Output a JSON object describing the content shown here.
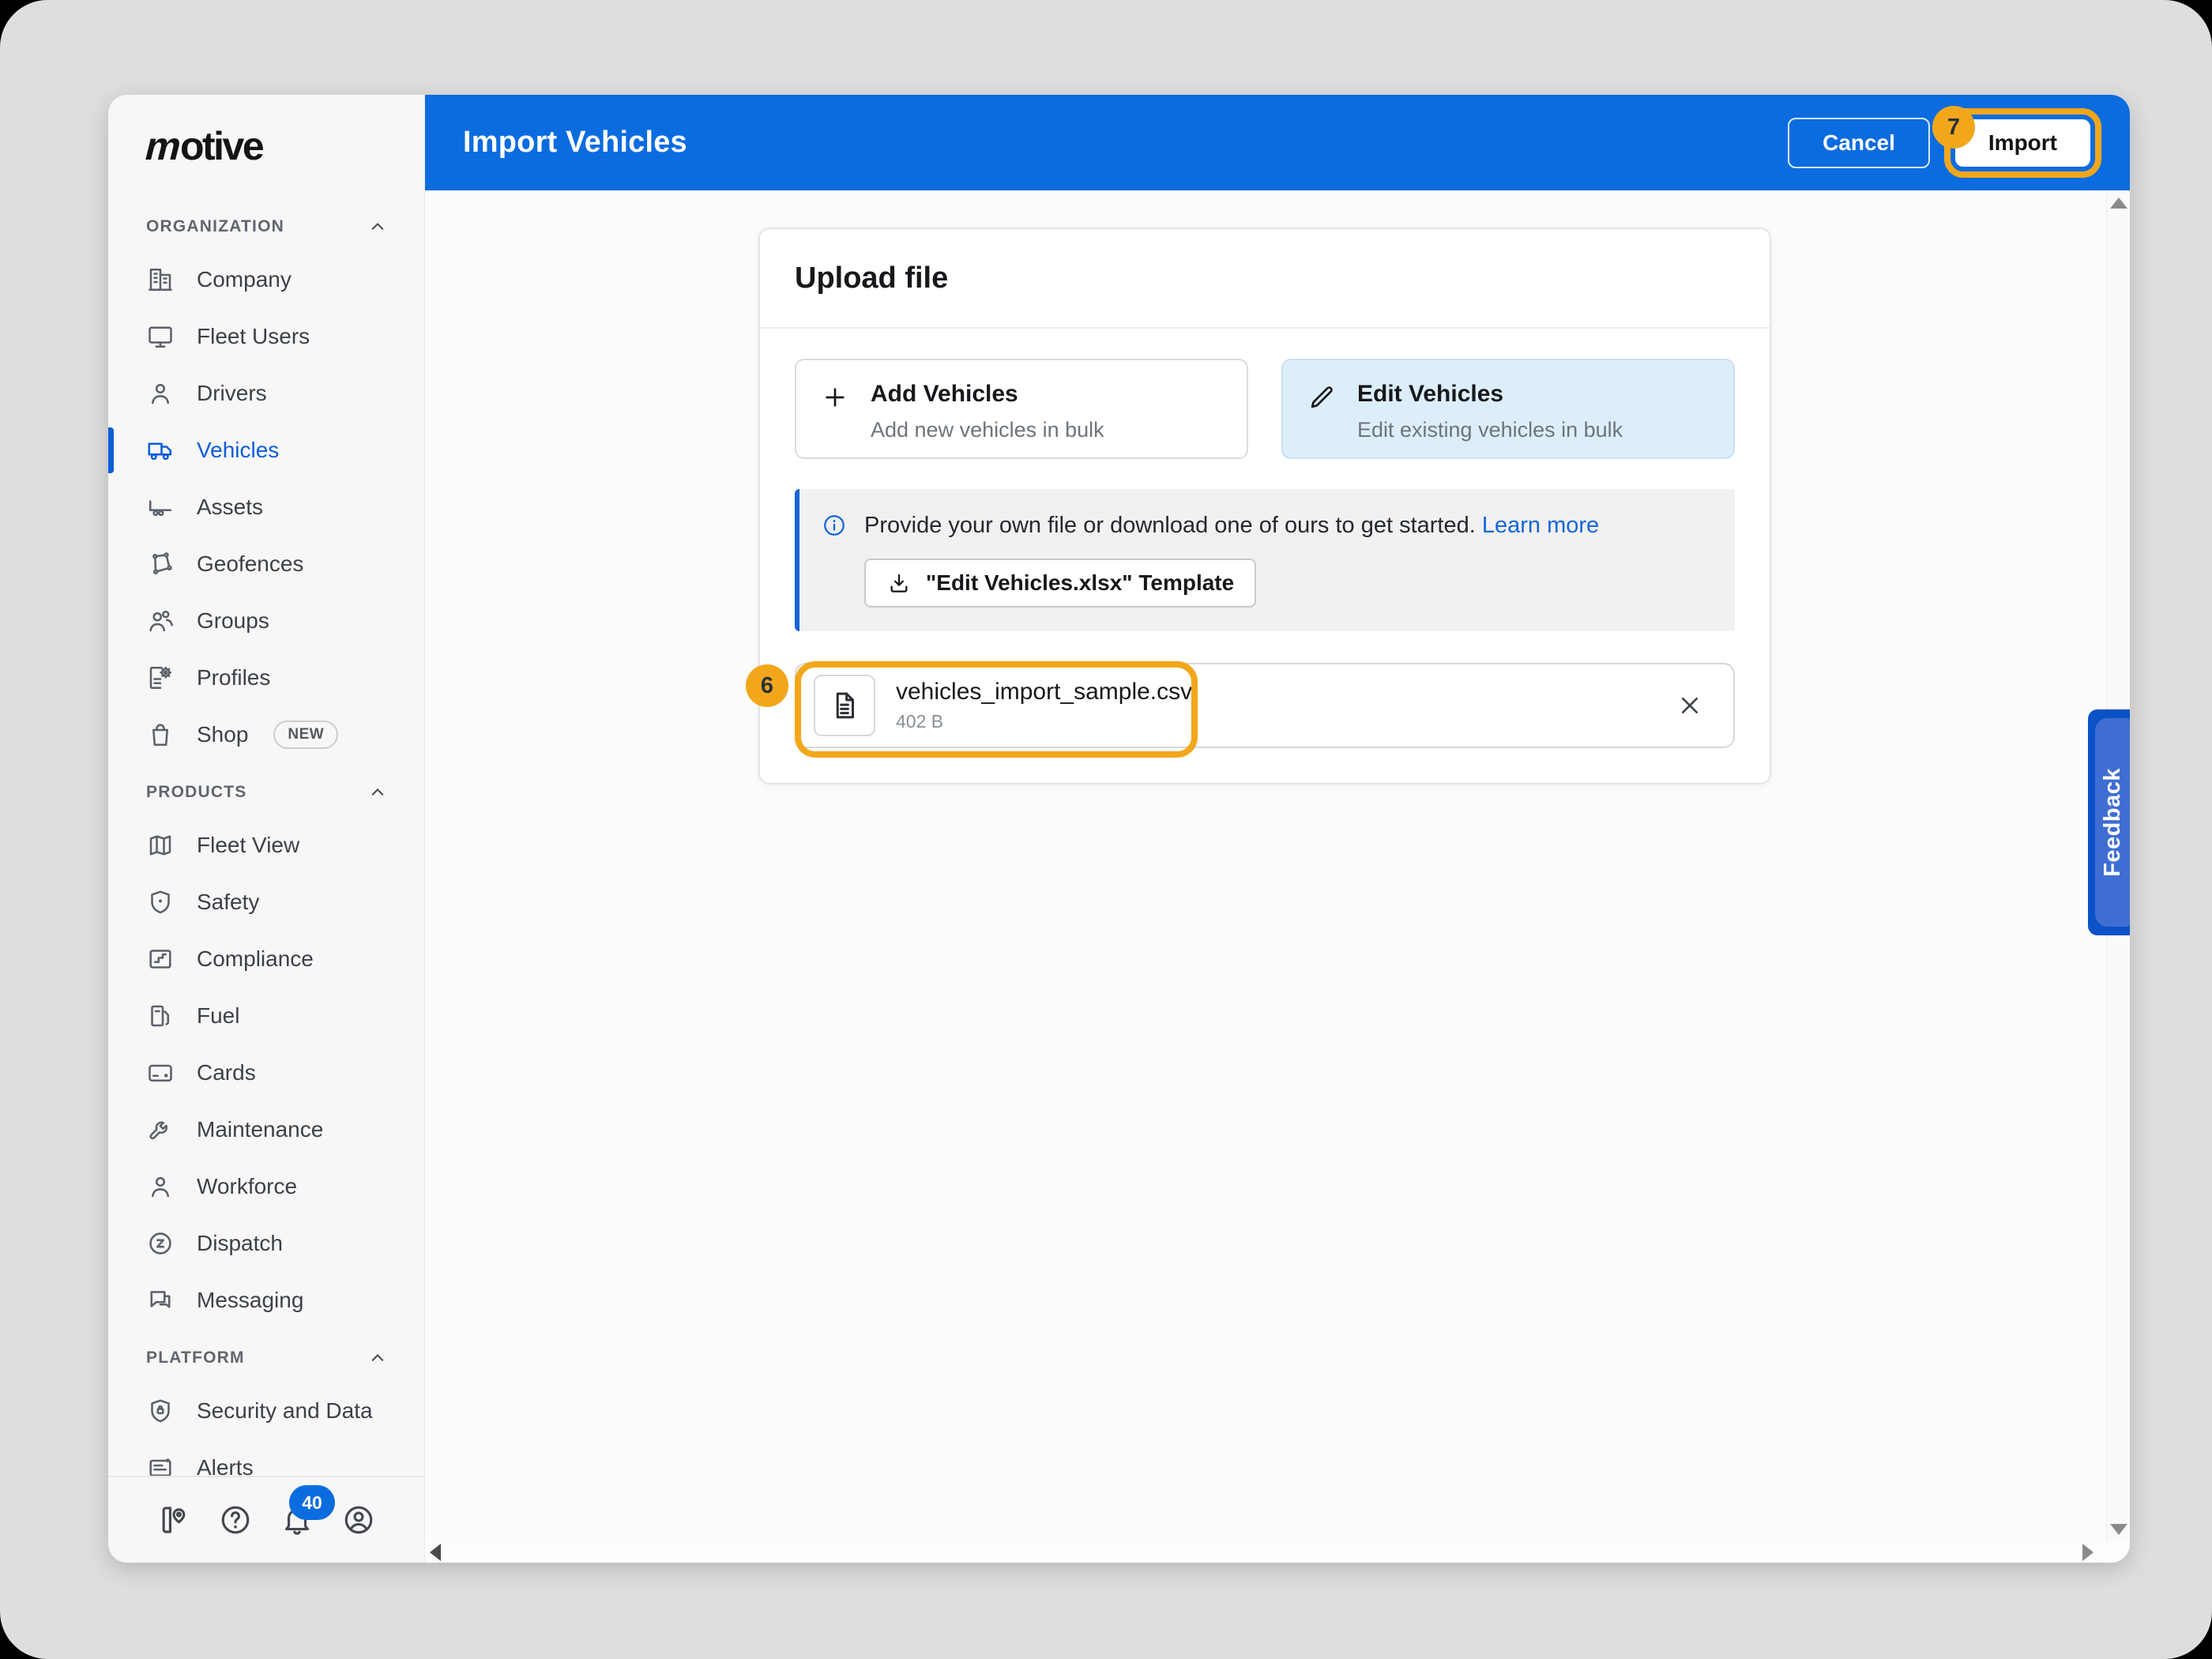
{
  "header": {
    "title": "Import Vehicles",
    "cancel_label": "Cancel",
    "import_label": "Import"
  },
  "annotations": {
    "step_6": "6",
    "step_7": "7"
  },
  "sidebar": {
    "logo_text": "motive",
    "notification_count": "40",
    "sections": [
      {
        "label": "ORGANIZATION",
        "items": [
          {
            "label": "Company",
            "icon": "building"
          },
          {
            "label": "Fleet Users",
            "icon": "monitor"
          },
          {
            "label": "Drivers",
            "icon": "user"
          },
          {
            "label": "Vehicles",
            "icon": "truck",
            "active": true
          },
          {
            "label": "Assets",
            "icon": "trailer"
          },
          {
            "label": "Geofences",
            "icon": "polygon"
          },
          {
            "label": "Groups",
            "icon": "users"
          },
          {
            "label": "Profiles",
            "icon": "profile-doc"
          },
          {
            "label": "Shop",
            "icon": "bag",
            "badge": "NEW"
          }
        ]
      },
      {
        "label": "PRODUCTS",
        "items": [
          {
            "label": "Fleet View",
            "icon": "map"
          },
          {
            "label": "Safety",
            "icon": "shield"
          },
          {
            "label": "Compliance",
            "icon": "clipboard"
          },
          {
            "label": "Fuel",
            "icon": "fuel"
          },
          {
            "label": "Cards",
            "icon": "credit-card"
          },
          {
            "label": "Maintenance",
            "icon": "wrench"
          },
          {
            "label": "Workforce",
            "icon": "user"
          },
          {
            "label": "Dispatch",
            "icon": "dispatch"
          },
          {
            "label": "Messaging",
            "icon": "chat"
          }
        ]
      },
      {
        "label": "PLATFORM",
        "items": [
          {
            "label": "Security and Data",
            "icon": "shield-lock"
          },
          {
            "label": "Alerts",
            "icon": "alert-card"
          }
        ]
      }
    ]
  },
  "upload_card": {
    "title": "Upload file",
    "options": [
      {
        "title": "Add Vehicles",
        "description": "Add new vehicles in bulk",
        "selected": false
      },
      {
        "title": "Edit Vehicles",
        "description": "Edit existing vehicles in bulk",
        "selected": true
      }
    ],
    "info_text": "Provide your own file or download one of ours to get started.",
    "learn_more_label": "Learn more",
    "template_button_label": "\"Edit Vehicles.xlsx\" Template",
    "file": {
      "name": "vehicles_import_sample.csv",
      "size": "402 B"
    }
  },
  "feedback_tab_label": "Feedback",
  "colors": {
    "header_blue": "#0b6cdf",
    "accent_blue": "#1565d8",
    "active_item_blue": "#0d5ed8",
    "annotation_amber": "#f2a71b",
    "selected_option_bg": "#ddeefb",
    "feedback_outer_blue": "#0a52c6",
    "feedback_inner_blue": "#3f6ed2"
  }
}
